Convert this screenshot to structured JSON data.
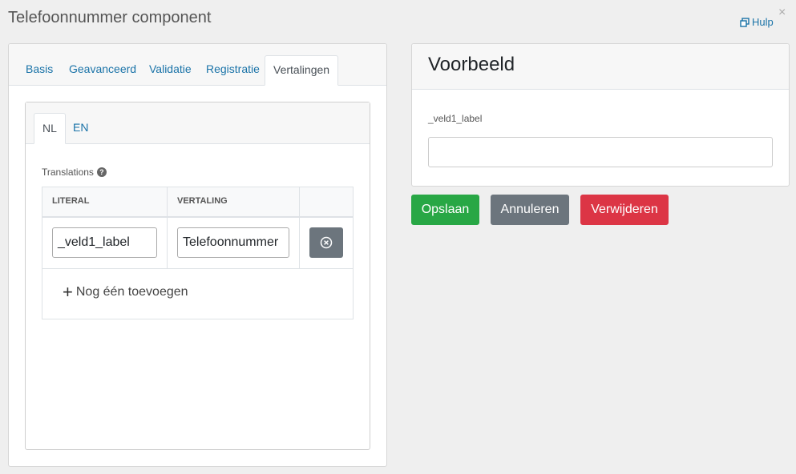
{
  "header": {
    "title": "Telefoonnummer component",
    "help_label": "Hulp",
    "close_glyph": "×"
  },
  "left": {
    "tabs": [
      {
        "label": "Basis"
      },
      {
        "label": "Geavanceerd"
      },
      {
        "label": "Validatie"
      },
      {
        "label": "Registratie"
      },
      {
        "label": "Vertalingen"
      }
    ],
    "active_tab": "Vertalingen",
    "lang_tabs": [
      {
        "label": "NL"
      },
      {
        "label": "EN"
      }
    ],
    "active_lang": "NL",
    "translations_label": "Translations",
    "help_glyph": "?",
    "table": {
      "columns": [
        "LITERAL",
        "VERTALING"
      ],
      "rows": [
        {
          "literal": "_veld1_label",
          "vertaling": "Telefoonnummer"
        }
      ],
      "add_label": "Nog één toevoegen",
      "add_glyph": "+"
    }
  },
  "preview": {
    "title": "Voorbeeld",
    "field_label": "_veld1_label",
    "field_value": ""
  },
  "actions": {
    "save": "Opslaan",
    "cancel": "Annuleren",
    "delete": "Verwijderen"
  },
  "colors": {
    "link": "#1a73a8",
    "save": "#28a745",
    "cancel": "#6c757d",
    "delete": "#dc3545"
  }
}
